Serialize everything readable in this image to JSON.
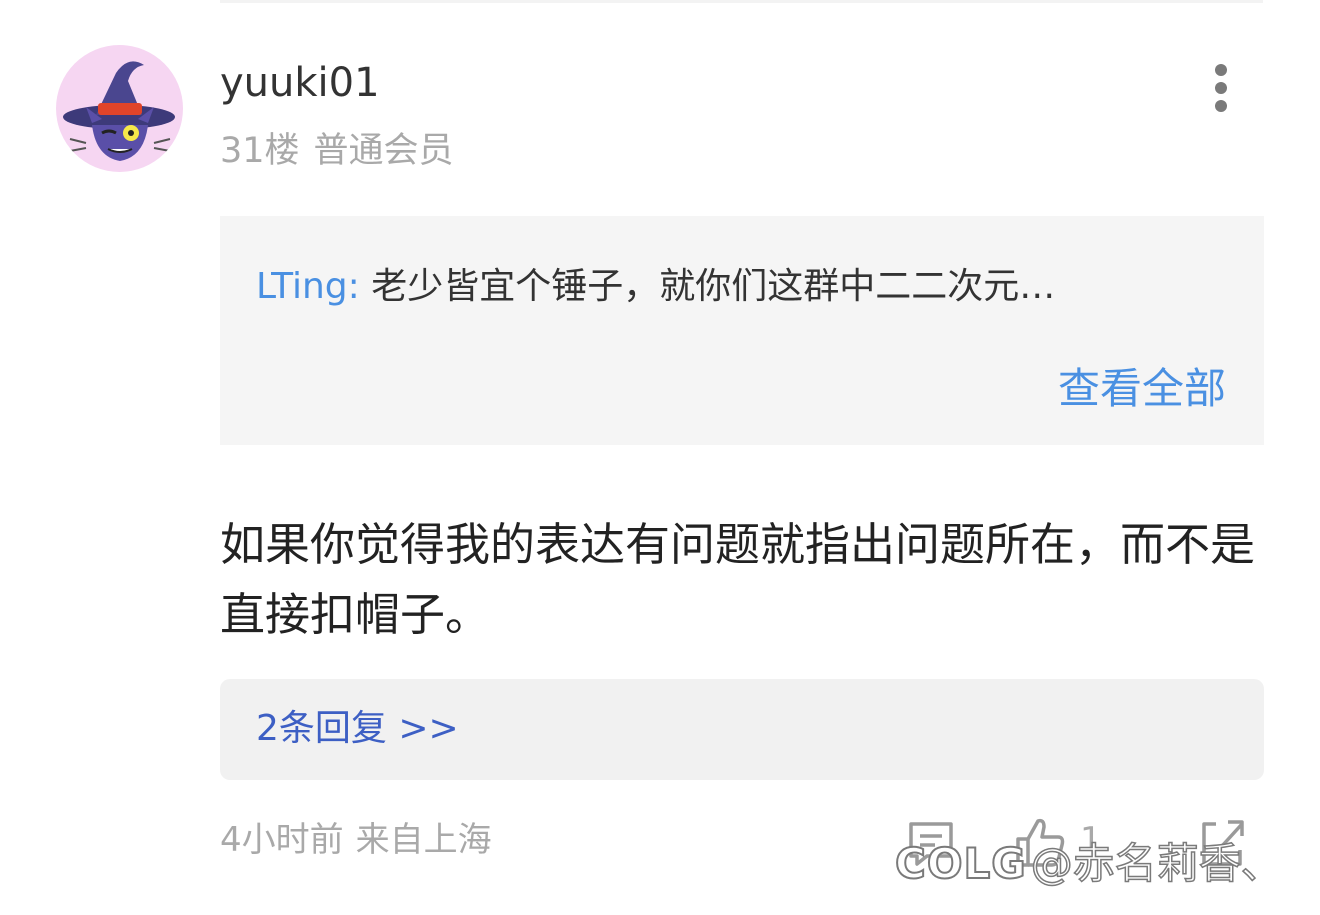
{
  "post": {
    "author": {
      "name": "yuuki01",
      "avatar_icon": "purple-witch-cat-avatar"
    },
    "floor": "31楼",
    "member_level": "普通会员",
    "more_icon": "more-vertical-icon",
    "quote": {
      "author": "LTing:",
      "text": "老少皆宜个锤子，就你们这群中二二次元…",
      "view_all": "查看全部"
    },
    "body": "如果你觉得我的表达有问题就指出问题所在，而不是直接扣帽子。",
    "replies_link": "2条回复 >>",
    "time": "4小时前",
    "location": "来自上海",
    "actions": {
      "comment_icon": "comment-icon",
      "like_icon": "thumbs-up-icon",
      "like_count": "1",
      "share_icon": "share-icon"
    }
  },
  "watermark": {
    "logo": "COLG",
    "text": "@赤名莉香、"
  },
  "colors": {
    "link_blue": "#4a90e2",
    "reply_blue": "#3d5fc4",
    "secondary_gray": "#a9a9a9",
    "avatar_bg": "#f6d6f2"
  }
}
